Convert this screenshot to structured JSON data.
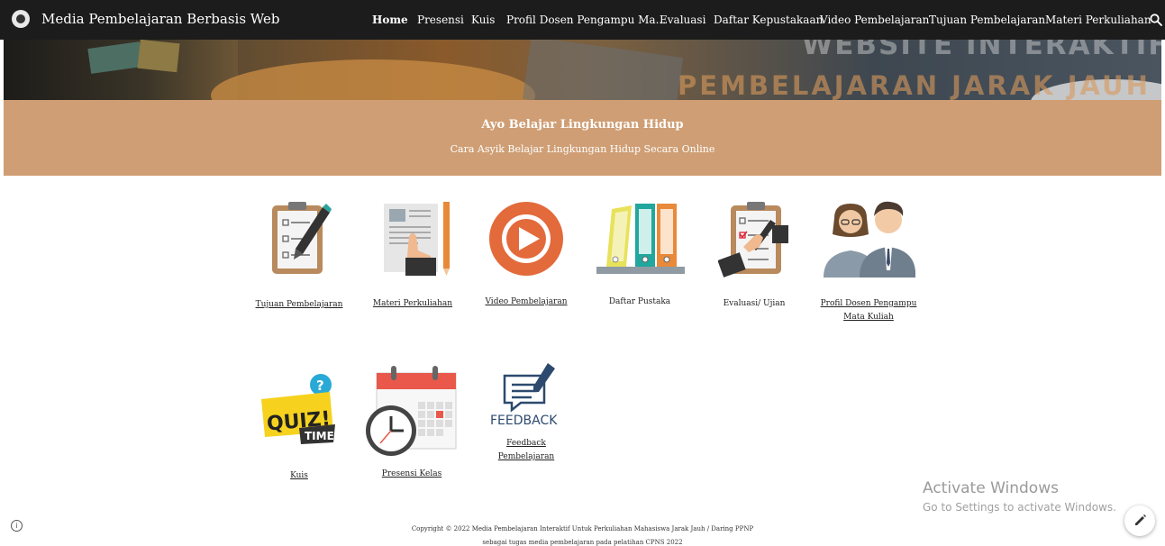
{
  "site": {
    "title": "Media Pembelajaran Berbasis Web"
  },
  "nav": {
    "items": [
      {
        "label": "Home",
        "active": true
      },
      {
        "label": "Presensi"
      },
      {
        "label": "Kuis"
      },
      {
        "label": "Profil Dosen Pengampu Ma..."
      },
      {
        "label": "Evaluasi"
      },
      {
        "label": "Daftar Kepustakaan"
      },
      {
        "label": "Video Pembelajaran"
      },
      {
        "label": "Tujuan Pembelajaran"
      },
      {
        "label": "Materi Perkuliahan"
      }
    ],
    "search_icon": "search-icon"
  },
  "banner": {
    "line1": "WEBSITE INTERAKTIF",
    "line2": "PEMBELAJARAN JARAK JAUH"
  },
  "hero": {
    "title": "Ayo Belajar Lingkungan Hidup",
    "subtitle": "Cara Asyik Belajar Lingkungan Hidup Secara Online",
    "background": "#cf9e74"
  },
  "cards": [
    {
      "label": "Tujuan Pembelajaran",
      "icon": "clipboard-pen-icon"
    },
    {
      "label": "Materi Perkuliahan",
      "icon": "document-pencil-icon"
    },
    {
      "label": "Video Pembelajaran",
      "icon": "play-button-icon"
    },
    {
      "label": "Daftar Pustaka",
      "icon": "binders-icon"
    },
    {
      "label": "Evaluasi/ Ujian",
      "icon": "clipboard-check-icon"
    },
    {
      "label": "Profil Dosen Pengampu Mata Kuliah",
      "line1": "Profil Dosen Pengampu ",
      "line2": "Mata Kuliah",
      "icon": "people-icon"
    },
    {
      "label": "Kuis",
      "icon": "quiz-time-icon"
    },
    {
      "label": "Presensi Kelas",
      "icon": "calendar-clock-icon"
    },
    {
      "label": "Feedback Pembelajaran",
      "line1": "Feedback ",
      "line2": "Pembelajaran",
      "icon": "feedback-icon",
      "icon_text": "FEEDBACK"
    }
  ],
  "quiz_icon_text": {
    "q": "?",
    "quiz": "QUIZ!",
    "time": "TIME"
  },
  "footer": {
    "copyright": "Copyright © 2022 Media Pembelajaran Interaktif Untuk Perkuliahan Mahasiswa Jarak Jauh / Daring PPNP",
    "second": "sebagai tugas media pembelajaran pada pelatihan CPNS 2022"
  },
  "watermark": {
    "title": "Activate Windows",
    "subtitle": "Go to Settings to activate Windows."
  },
  "colors": {
    "topbar": "#1c1c1c",
    "accent": "#cf9e74",
    "play": "#e36a3b"
  }
}
